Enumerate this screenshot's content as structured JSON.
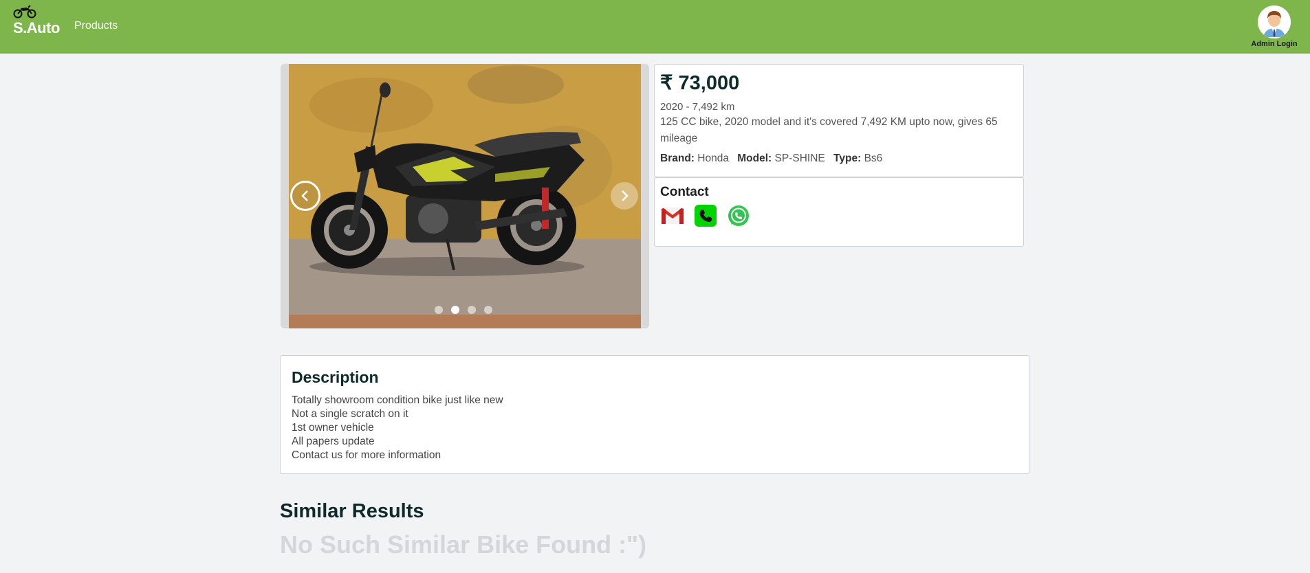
{
  "header": {
    "brand": "S.Auto",
    "nav_products": "Products",
    "admin_label": "Admin Login",
    "bg_color": "#7eb64b"
  },
  "carousel": {
    "slides_total": 4,
    "active_slide": 2,
    "prev_icon": "chevron-left-icon",
    "next_icon": "chevron-right-icon"
  },
  "listing": {
    "price": "₹ 73,000",
    "year_km": "2020 - 7,492 km",
    "summary": "125 CC bike, 2020 model and it's covered 7,492 KM upto now, gives 65 mileage",
    "brand_label": "Brand:",
    "brand_value": "Honda",
    "model_label": "Model:",
    "model_value": "SP-SHINE",
    "type_label": "Type:",
    "type_value": "Bs6"
  },
  "contact": {
    "title": "Contact",
    "icons": [
      "gmail-icon",
      "phone-icon",
      "whatsapp-icon"
    ]
  },
  "description": {
    "title": "Description",
    "lines": [
      "Totally showroom condition bike just like new",
      "Not a single scratch on it",
      "1st owner vehicle",
      "All papers update",
      "Contact us for more information"
    ]
  },
  "similar": {
    "title": "Similar Results",
    "empty_message": "No Such Similar Bike Found :\")"
  }
}
